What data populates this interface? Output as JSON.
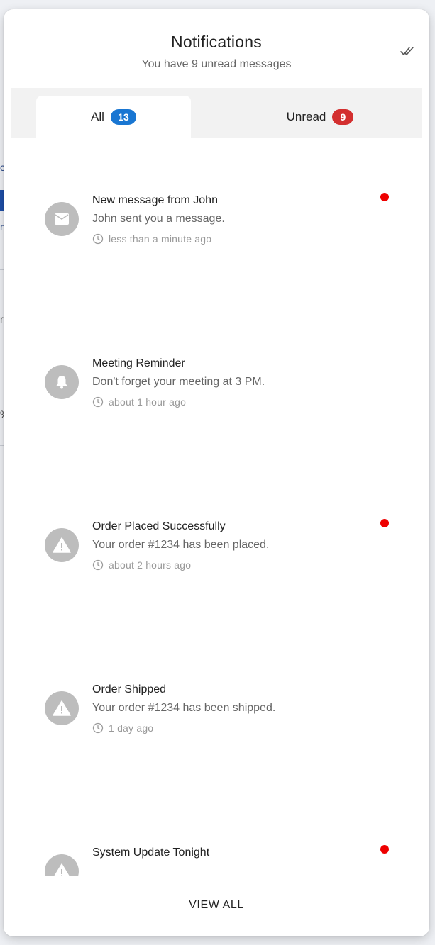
{
  "colors": {
    "badge_all": "#1976d2",
    "badge_unread": "#d32f2f",
    "unread_dot": "#ee0000",
    "avatar_bg": "#bdbdbd"
  },
  "header": {
    "title": "Notifications",
    "subtitle": "You have 9 unread messages",
    "mark_all_icon": "double-check-icon"
  },
  "tabs": [
    {
      "label": "All",
      "count": "13",
      "selected": true
    },
    {
      "label": "Unread",
      "count": "9",
      "selected": false
    }
  ],
  "notifications": [
    {
      "title": "New message from John",
      "body": "John sent you a message.",
      "time": "less than a minute ago",
      "icon": "mail-icon",
      "unread": true
    },
    {
      "title": "Meeting Reminder",
      "body": "Don't forget your meeting at 3 PM.",
      "time": "about 1 hour ago",
      "icon": "bell-icon",
      "unread": false
    },
    {
      "title": "Order Placed Successfully",
      "body": "Your order #1234 has been placed.",
      "time": "about 2 hours ago",
      "icon": "warning-icon",
      "unread": true
    },
    {
      "title": "Order Shipped",
      "body": "Your order #1234 has been shipped.",
      "time": "1 day ago",
      "icon": "warning-icon",
      "unread": false
    },
    {
      "title": "System Update Tonight",
      "body": "",
      "time": "",
      "icon": "warning-icon",
      "unread": true
    }
  ],
  "footer": {
    "view_all": "VIEW ALL"
  }
}
